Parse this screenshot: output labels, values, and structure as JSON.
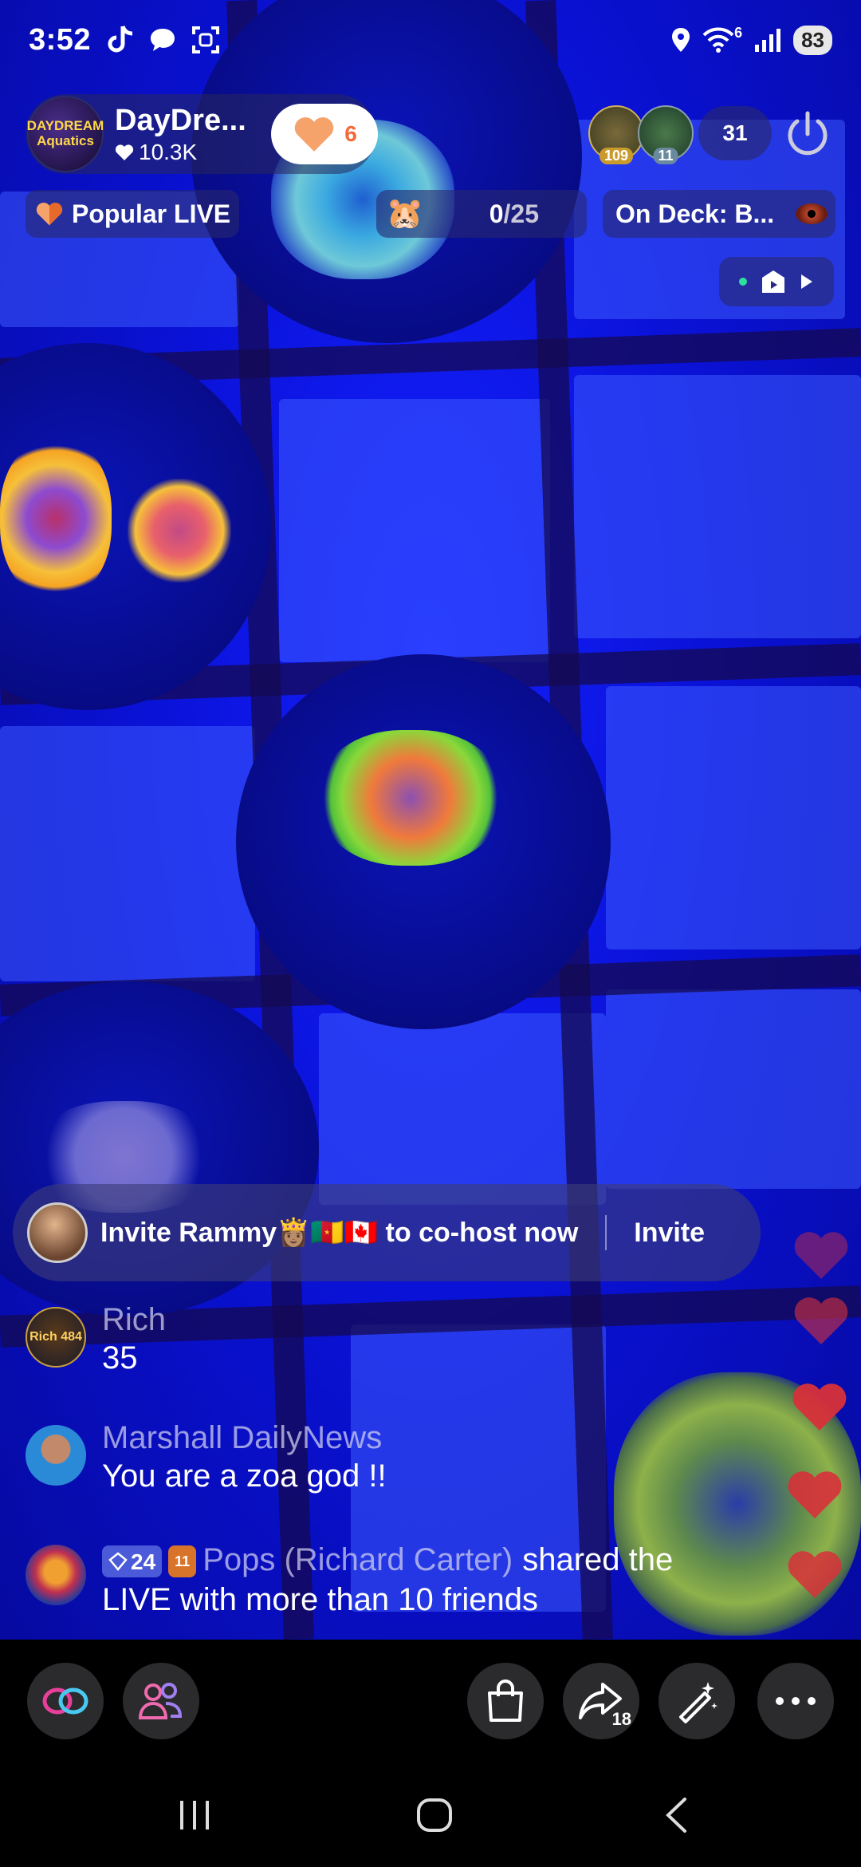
{
  "status_bar": {
    "time": "3:52",
    "network_label": "6",
    "battery": "83",
    "icons": [
      "tiktok-icon",
      "chat-bubble-icon",
      "screenshot-icon",
      "location-icon",
      "wifi-icon",
      "signal-icon",
      "battery-icon"
    ]
  },
  "host": {
    "name": "DayDre...",
    "likes": "10.3K",
    "avatar_text": "DAYDREAM Aquatics",
    "follow_count": "6"
  },
  "viewers": {
    "ranks": [
      "109",
      "11"
    ],
    "count": "31"
  },
  "chips": {
    "popular": "Popular LIVE",
    "progress_current": "0",
    "progress_total": "/25",
    "on_deck": "On Deck: B..."
  },
  "invite": {
    "text": "Invite Rammy👸🏽🇨🇲🇨🇦 to co-host now",
    "button": "Invite"
  },
  "comments": [
    {
      "user": "Rich",
      "text": "35",
      "avatar_text": "Rich 484"
    },
    {
      "user": "Marshall DailyNews",
      "text": "You are a zoa god !!"
    },
    {
      "badge_level": "24",
      "badge_icon": "11",
      "user": "Pops (Richard Carter)",
      "text_inline": "shared the",
      "text": "LIVE with more than 10 friends"
    }
  ],
  "toolbar": {
    "share_count": "18",
    "buttons": [
      "co-host-icon",
      "multi-guest-icon",
      "shop-bag-icon",
      "share-icon",
      "effects-wand-icon",
      "more-icon"
    ]
  },
  "colors": {
    "accent_orange": "#f26a3a",
    "heart_red": "#d8313a",
    "scene_blue": "#0a12d8"
  }
}
